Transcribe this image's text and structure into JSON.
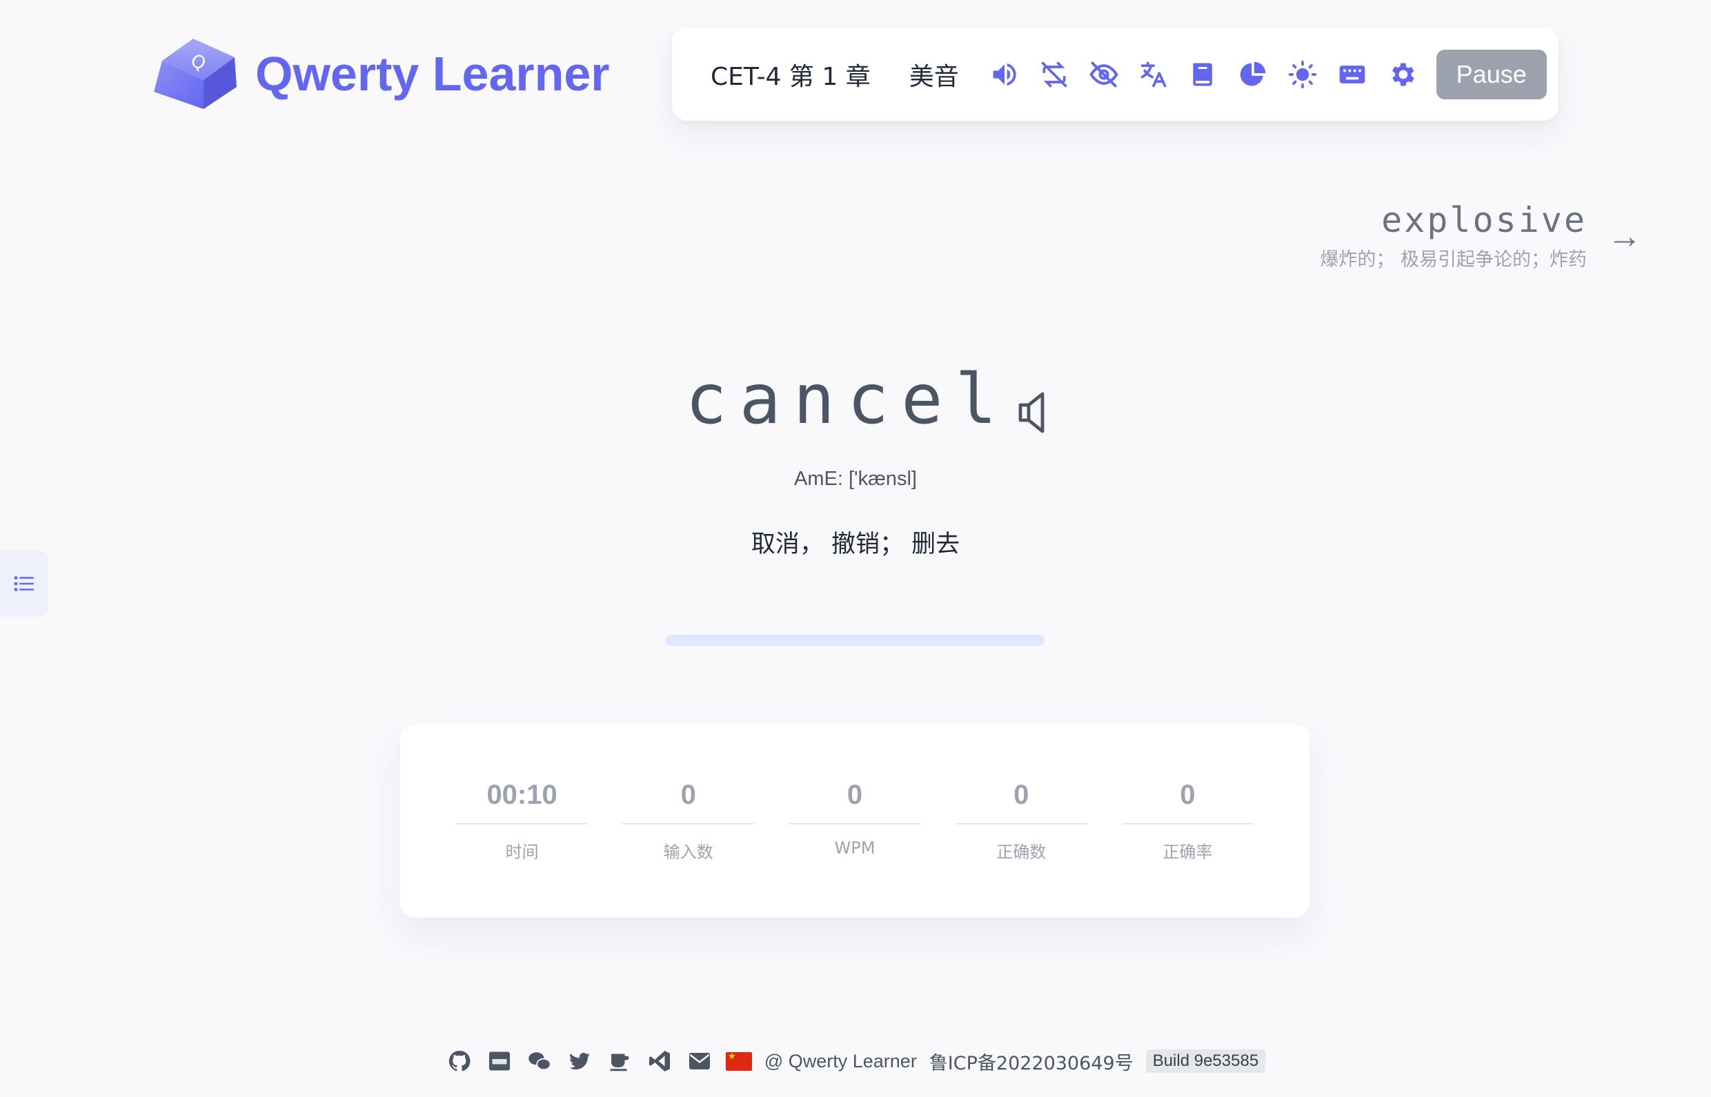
{
  "app": {
    "title": "Qwerty Learner"
  },
  "toolbar": {
    "chapter": "CET-4 第 1 章",
    "accent": "美音",
    "icons": [
      "speaker-icon",
      "loop-off-icon",
      "eye-off-icon",
      "translate-icon",
      "book-icon",
      "chart-pie-icon",
      "sun-icon",
      "keyboard-icon",
      "gear-icon"
    ],
    "pause_label": "Pause"
  },
  "next_word": {
    "word": "explosive",
    "translation": "爆炸的； 极易引起争论的；炸药"
  },
  "current_word": {
    "word": "cancel",
    "phonetic": "AmE: ['kænsl]",
    "translation": "取消， 撤销； 删去"
  },
  "progress": {
    "value": 0
  },
  "stats": [
    {
      "value": "00:10",
      "label": "时间"
    },
    {
      "value": "0",
      "label": "输入数"
    },
    {
      "value": "0",
      "label": "WPM"
    },
    {
      "value": "0",
      "label": "正确数"
    },
    {
      "value": "0",
      "label": "正确率"
    }
  ],
  "footer": {
    "copyright": "@ Qwerty Learner",
    "icp": "鲁ICP备2022030649号",
    "build": "Build 9e53585"
  },
  "colors": {
    "accent": "#6366f1",
    "pause_button": "#9ca3af"
  }
}
